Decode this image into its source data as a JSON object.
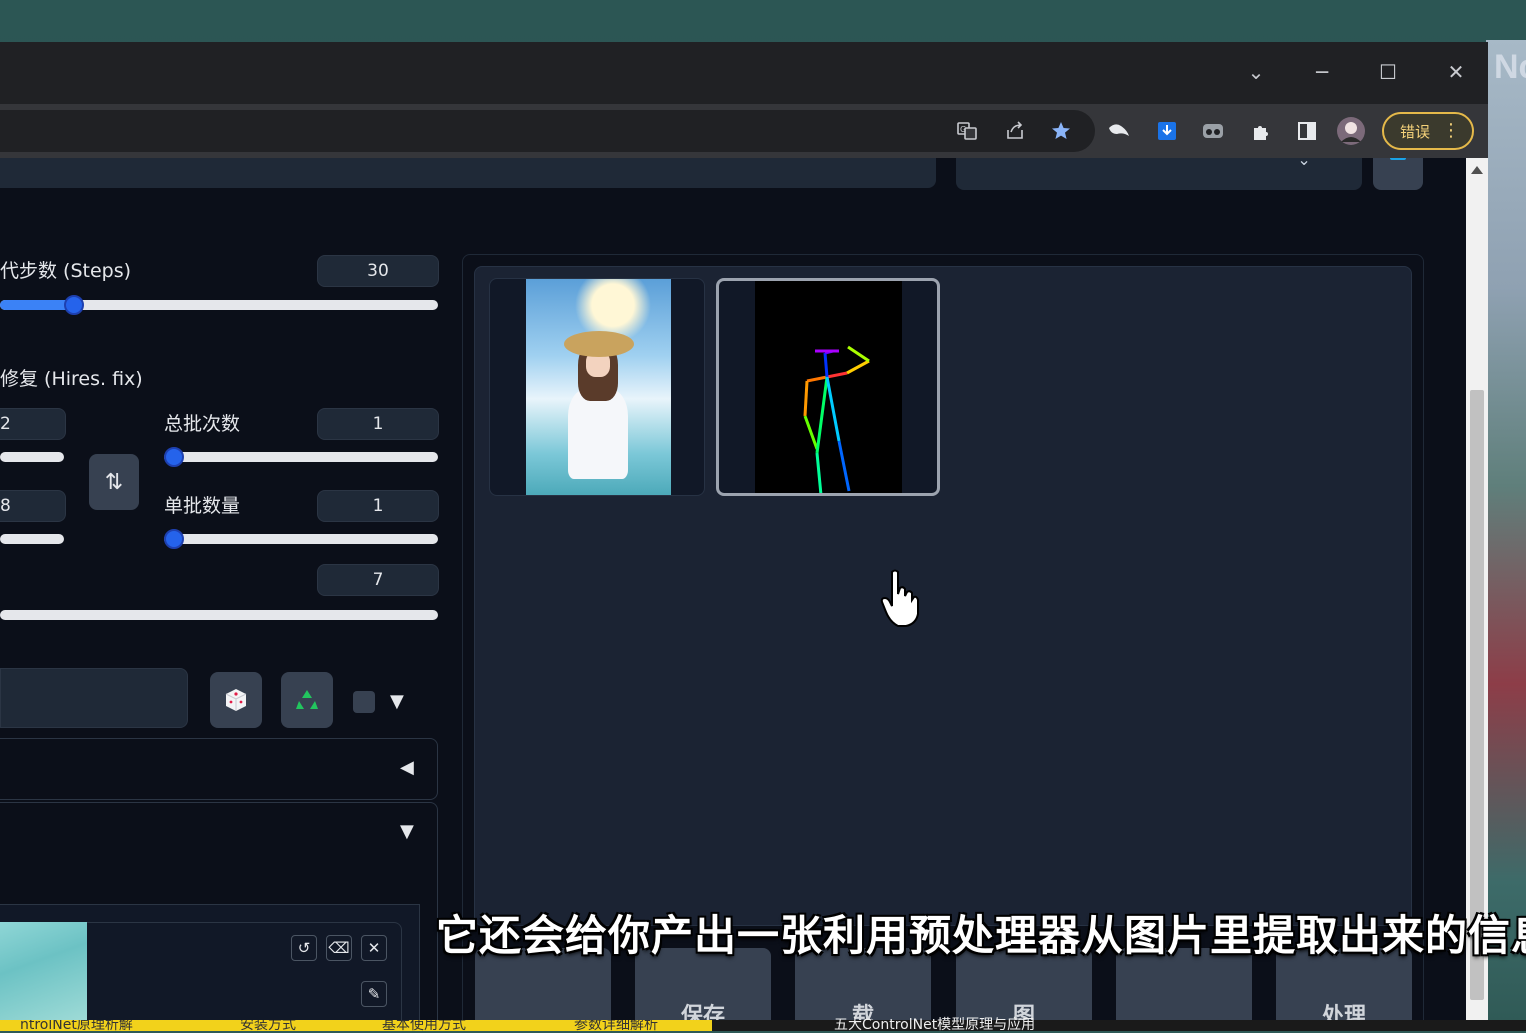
{
  "browser": {
    "window_controls": {
      "tabs": "⌄",
      "minimize": "─",
      "maximize": "☐",
      "close": "✕"
    },
    "toolbar": {
      "error_pill_label": "错误",
      "menu_glyph": "⋮"
    },
    "desktop_overlay_text": "Nc"
  },
  "left_panel": {
    "steps_label": "代步数 (Steps)",
    "steps_value": "30",
    "steps_fraction": 0.17,
    "hires_label": "修复 (Hires. fix)",
    "width_partial": "2",
    "height_partial": "8",
    "batch_count_label": "总批次数",
    "batch_count_value": "1",
    "batch_size_label": "单批数量",
    "batch_size_value": "1",
    "cfg_value": "7",
    "swap_glyph": "⇅",
    "seed_buttons": {
      "dice": "🎲",
      "recycle": "♻"
    }
  },
  "gallery": {
    "images": [
      "generated-image",
      "pose-skeleton-image"
    ],
    "selected_index": 1
  },
  "actions": {
    "buttons": [
      "",
      "保存",
      "载",
      "图",
      "",
      "处理"
    ]
  },
  "subtitle": "它还会给你产出一张利用预处理器从图片里提取出来的信息图",
  "bottom_bar": {
    "chapters": [
      "ntrolNet原理析解",
      "安装方式",
      "基本使用方式",
      "参数详细解析"
    ],
    "right_text": "五大ControlNet模型原理与应用"
  },
  "colors": {
    "accent": "#3b82f6",
    "page_bg": "#0b0f19",
    "error_pill": "#e5b94a",
    "chapter_bar": "#f2d21b"
  }
}
